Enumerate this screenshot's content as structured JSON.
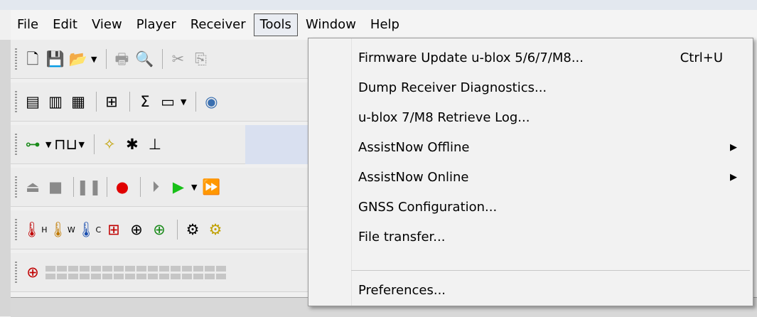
{
  "menubar": {
    "items": [
      {
        "label": "File"
      },
      {
        "label": "Edit"
      },
      {
        "label": "View"
      },
      {
        "label": "Player"
      },
      {
        "label": "Receiver"
      },
      {
        "label": "Tools"
      },
      {
        "label": "Window"
      },
      {
        "label": "Help"
      }
    ],
    "open_menu": "Tools"
  },
  "tools_menu": {
    "items": [
      {
        "label": "Firmware Update u-blox 5/6/7/M8...",
        "shortcut": "Ctrl+U",
        "submenu": false
      },
      {
        "label": "Dump Receiver Diagnostics...",
        "submenu": false
      },
      {
        "label": "u-blox 7/M8 Retrieve Log...",
        "submenu": false
      },
      {
        "label": "AssistNow Offline",
        "submenu": true
      },
      {
        "label": "AssistNow Online",
        "submenu": true
      },
      {
        "label": "GNSS Configuration...",
        "submenu": false
      },
      {
        "label": "File transfer...",
        "submenu": false
      },
      {
        "label": "Preferences...",
        "submenu": false
      }
    ]
  },
  "toolbar_icons": {
    "thermo": [
      "H",
      "W",
      "C"
    ]
  },
  "colors": {
    "record": "#e00000",
    "play": "#18c018",
    "panel": "#d9e0f0"
  }
}
